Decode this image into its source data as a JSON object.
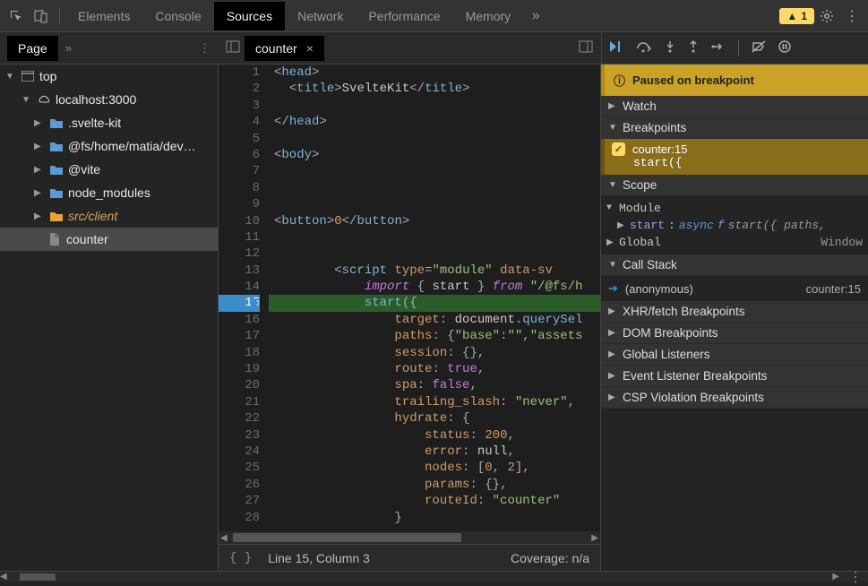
{
  "toolbar": {
    "tabs": [
      "Elements",
      "Console",
      "Sources",
      "Network",
      "Performance",
      "Memory"
    ],
    "active_tab": "Sources",
    "warning_count": "1"
  },
  "page_panel": {
    "label": "Page"
  },
  "file_tab": {
    "name": "counter"
  },
  "tree": {
    "root": "top",
    "host": "localhost:3000",
    "nodes": [
      {
        "label": ".svelte-kit",
        "kind": "folder-blue"
      },
      {
        "label": "@fs/home/matia/dev…",
        "kind": "folder-blue"
      },
      {
        "label": "@vite",
        "kind": "folder-blue"
      },
      {
        "label": "node_modules",
        "kind": "folder-blue"
      },
      {
        "label": "src/client",
        "kind": "folder-orange",
        "italic": true
      }
    ],
    "file": "counter"
  },
  "code": {
    "lines": [
      {
        "n": 1,
        "html": "<span class='tok-punc'>&lt;</span><span class='tok-tag'>head</span><span class='tok-punc'>&gt;</span>"
      },
      {
        "n": 2,
        "html": "  <span class='tok-punc'>&lt;</span><span class='tok-tag'>title</span><span class='tok-punc'>&gt;</span>SvelteKit<span class='tok-punc'>&lt;/</span><span class='tok-tag'>title</span><span class='tok-punc'>&gt;</span>"
      },
      {
        "n": 3,
        "html": ""
      },
      {
        "n": 4,
        "html": "<span class='tok-punc'>&lt;/</span><span class='tok-tag'>head</span><span class='tok-punc'>&gt;</span>"
      },
      {
        "n": 5,
        "html": ""
      },
      {
        "n": 6,
        "html": "<span class='tok-punc'>&lt;</span><span class='tok-tag'>body</span><span class='tok-punc'>&gt;</span>"
      },
      {
        "n": 7,
        "html": ""
      },
      {
        "n": 8,
        "html": ""
      },
      {
        "n": 9,
        "html": ""
      },
      {
        "n": 10,
        "html": "<span class='tok-punc'>&lt;</span><span class='tok-tag'>button</span><span class='tok-punc'>&gt;</span><span class='tok-num'>0</span><span class='tok-punc'>&lt;/</span><span class='tok-tag'>button</span><span class='tok-punc'>&gt;</span>"
      },
      {
        "n": 11,
        "html": ""
      },
      {
        "n": 12,
        "html": ""
      },
      {
        "n": 13,
        "html": "        <span class='tok-punc'>&lt;</span><span class='tok-tag'>script</span> <span class='tok-key'>type</span><span class='tok-eq'>=</span><span class='tok-str'>\"module\"</span> <span class='tok-key'>data-sv</span>"
      },
      {
        "n": 14,
        "html": "            <span class='tok-kw'>import</span> <span class='tok-punc'>{</span> start <span class='tok-punc'>}</span> <span class='tok-kw'>from</span> <span class='tok-str'>\"/@fs/h</span>"
      },
      {
        "n": 15,
        "html": "            <span class='tok-fn'>start</span><span class='tok-punc'>({</span>",
        "exec": true
      },
      {
        "n": 16,
        "html": "                <span class='tok-prop'>target</span><span class='tok-punc'>:</span> document<span class='tok-punc'>.</span><span class='tok-fn'>querySel</span>"
      },
      {
        "n": 17,
        "html": "                <span class='tok-prop'>paths</span><span class='tok-punc'>:</span> <span class='tok-punc'>{</span><span class='tok-str'>\"base\"</span><span class='tok-punc'>:</span><span class='tok-str'>\"\"</span><span class='tok-punc'>,</span><span class='tok-str'>\"assets</span>"
      },
      {
        "n": 18,
        "html": "                <span class='tok-prop'>session</span><span class='tok-punc'>:</span> <span class='tok-punc'>{}</span><span class='tok-punc'>,</span>"
      },
      {
        "n": 19,
        "html": "                <span class='tok-prop'>route</span><span class='tok-punc'>:</span> <span class='tok-bool'>true</span><span class='tok-punc'>,</span>"
      },
      {
        "n": 20,
        "html": "                <span class='tok-prop'>spa</span><span class='tok-punc'>:</span> <span class='tok-bool'>false</span><span class='tok-punc'>,</span>"
      },
      {
        "n": 21,
        "html": "                <span class='tok-prop'>trailing_slash</span><span class='tok-punc'>:</span> <span class='tok-str'>\"never\"</span><span class='tok-punc'>,</span>"
      },
      {
        "n": 22,
        "html": "                <span class='tok-prop'>hydrate</span><span class='tok-punc'>:</span> <span class='tok-punc'>{</span>"
      },
      {
        "n": 23,
        "html": "                    <span class='tok-prop'>status</span><span class='tok-punc'>:</span> <span class='tok-num'>200</span><span class='tok-punc'>,</span>"
      },
      {
        "n": 24,
        "html": "                    <span class='tok-prop'>error</span><span class='tok-punc'>:</span> <span class='tok-null'>null</span><span class='tok-punc'>,</span>"
      },
      {
        "n": 25,
        "html": "                    <span class='tok-prop'>nodes</span><span class='tok-punc'>:</span> <span class='tok-punc'>[</span><span class='tok-num'>0</span><span class='tok-punc'>,</span> <span class='tok-num'>2</span><span class='tok-punc'>],</span>"
      },
      {
        "n": 26,
        "html": "                    <span class='tok-prop'>params</span><span class='tok-punc'>:</span> <span class='tok-punc'>{}</span><span class='tok-punc'>,</span>"
      },
      {
        "n": 27,
        "html": "                    <span class='tok-prop'>routeId</span><span class='tok-punc'>:</span> <span class='tok-str'>\"counter\"</span>"
      },
      {
        "n": 28,
        "html": "                <span class='tok-punc'>}</span>"
      }
    ]
  },
  "status": {
    "pos": "Line 15, Column 3",
    "coverage": "Coverage: n/a"
  },
  "debugger": {
    "paused_msg": "Paused on breakpoint",
    "sections": {
      "watch": "Watch",
      "breakpoints": "Breakpoints",
      "scope": "Scope",
      "callstack": "Call Stack",
      "xhr": "XHR/fetch Breakpoints",
      "dom": "DOM Breakpoints",
      "gl": "Global Listeners",
      "elb": "Event Listener Breakpoints",
      "csp": "CSP Violation Breakpoints"
    },
    "bp": {
      "label": "counter:15",
      "code": "start({"
    },
    "scope": {
      "module": "Module",
      "start": "start",
      "start_colon": ":",
      "async": "async",
      "f": "f",
      "sig": "start({ paths,",
      "global": "Global",
      "window": "Window"
    },
    "callstack": {
      "frame": "(anonymous)",
      "loc": "counter:15"
    }
  }
}
